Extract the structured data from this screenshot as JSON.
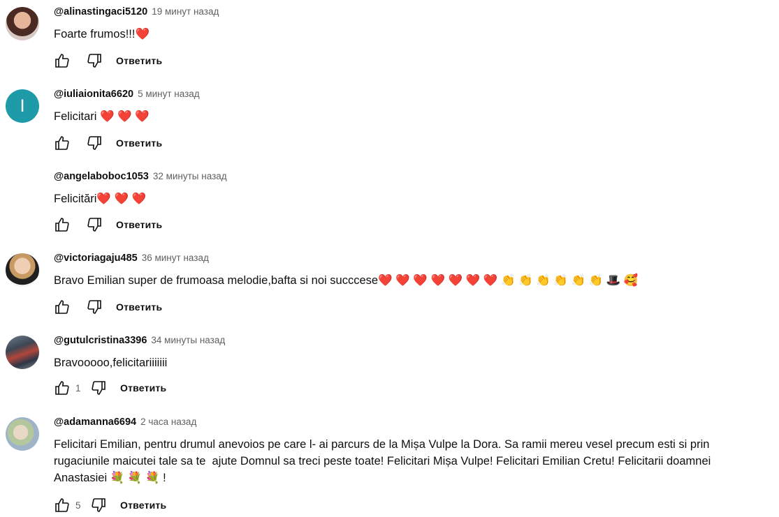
{
  "comments": [
    {
      "author": "@alinastingaci5120",
      "time": "19 минут назад",
      "text": "Foarte frumos!!!❤️",
      "likes": "",
      "reply": "Ответить"
    },
    {
      "author": "@iuliaionita6620",
      "time": "5 минут назад",
      "avatar_letter": "I",
      "text": "Felicitari ❤️ ❤️ ❤️",
      "likes": "",
      "reply": "Ответить"
    },
    {
      "author": "@angelaboboc1053",
      "time": "32 минуты назад",
      "text": "Felicitări❤️ ❤️ ❤️",
      "likes": "",
      "reply": "Ответить"
    },
    {
      "author": "@victoriagaju485",
      "time": "36 минут назад",
      "text": "Bravo Emilian super de frumoasa melodie,bafta si noi succcese❤️ ❤️ ❤️ ❤️ ❤️ ❤️ ❤️ 👏 👏 👏 👏 👏 👏 🎩 🥰",
      "likes": "",
      "reply": "Ответить"
    },
    {
      "author": "@gutulcristina3396",
      "time": "34 минуты назад",
      "text": "Bravooooo,felicitariiiiiii",
      "likes": "1",
      "reply": "Ответить"
    },
    {
      "author": "@adamanna6694",
      "time": "2 часа назад",
      "text": "Felicitari Emilian, pentru drumul anevoios pe care l- ai parcurs de la Mișa Vulpe la Dora. Sa ramii mereu vesel precum esti si prin rugaciunile maicutei tale sa te  ajute Domnul sa treci peste toate! Felicitari Mișa Vulpe! Felicitari Emilian Cretu! Felicitarii doamnei Anastasiei 💐 💐 💐 !",
      "likes": "5",
      "reply": "Ответить"
    }
  ],
  "icons": {
    "like": "thumbs-up-icon",
    "dislike": "thumbs-down-icon"
  }
}
